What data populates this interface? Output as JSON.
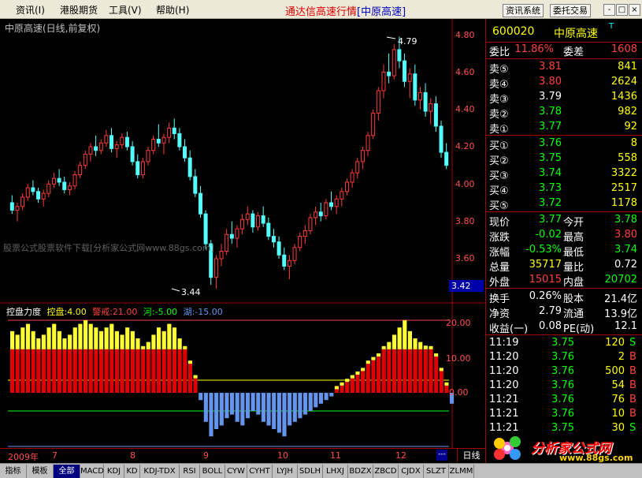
{
  "menu": {
    "items": [
      "资讯(I)",
      "港股期货",
      "工具(V)",
      "帮助(H)"
    ]
  },
  "app_title": {
    "main": "通达信高速行情",
    "sub": "[中原高速]"
  },
  "top_buttons": [
    "资讯系统",
    "委托交易"
  ],
  "window_buttons": [
    "-",
    "□",
    "×"
  ],
  "chart": {
    "title": "中原高速(日线,前复权)",
    "y_ticks": [
      "4.80",
      "4.60",
      "4.40",
      "4.20",
      "4.00",
      "3.80",
      "3.60"
    ],
    "cursor_price": "3.42",
    "high_annot": "4.79",
    "low_annot": "3.44",
    "watermark": "股票公式股票软件下载[分析家公式网www.88gs.com]",
    "indicator_ticks": [
      "20.00",
      "10.00",
      "0.00"
    ]
  },
  "indicator": {
    "name": "控盘力度",
    "items": [
      {
        "label": "控盘:4.00",
        "color": "#ffff00"
      },
      {
        "label": "警戒:21.00",
        "color": "#ff4040"
      },
      {
        "label": "河:-5.00",
        "color": "#00ff00"
      },
      {
        "label": "湖:-15.00",
        "color": "#6495ed"
      }
    ]
  },
  "chart_data": {
    "type": "candlestick",
    "high": 4.79,
    "low": 3.44,
    "candles": [
      [
        3.9,
        3.94,
        3.84,
        3.86
      ],
      [
        3.86,
        3.9,
        3.8,
        3.88
      ],
      [
        3.88,
        3.95,
        3.86,
        3.93
      ],
      [
        3.93,
        4.0,
        3.91,
        3.98
      ],
      [
        3.98,
        4.02,
        3.94,
        3.96
      ],
      [
        3.96,
        3.98,
        3.9,
        3.92
      ],
      [
        3.92,
        3.97,
        3.88,
        3.95
      ],
      [
        3.95,
        4.02,
        3.93,
        4.0
      ],
      [
        4.0,
        4.06,
        3.98,
        4.03
      ],
      [
        4.03,
        4.08,
        3.99,
        4.01
      ],
      [
        4.01,
        4.04,
        3.95,
        3.97
      ],
      [
        3.97,
        4.01,
        3.94,
        3.99
      ],
      [
        3.99,
        4.07,
        3.97,
        4.05
      ],
      [
        4.05,
        4.12,
        4.03,
        4.1
      ],
      [
        4.1,
        4.18,
        4.08,
        4.16
      ],
      [
        4.16,
        4.22,
        4.12,
        4.2
      ],
      [
        4.2,
        4.26,
        4.15,
        4.18
      ],
      [
        4.18,
        4.24,
        4.16,
        4.22
      ],
      [
        4.22,
        4.29,
        4.2,
        4.26
      ],
      [
        4.26,
        4.3,
        4.17,
        4.19
      ],
      [
        4.19,
        4.23,
        4.14,
        4.21
      ],
      [
        4.21,
        4.27,
        4.19,
        4.25
      ],
      [
        4.25,
        4.28,
        4.18,
        4.2
      ],
      [
        4.2,
        4.23,
        4.1,
        4.12
      ],
      [
        4.12,
        4.16,
        4.03,
        4.05
      ],
      [
        4.05,
        4.14,
        4.03,
        4.12
      ],
      [
        4.12,
        4.2,
        4.1,
        4.18
      ],
      [
        4.18,
        4.26,
        4.16,
        4.24
      ],
      [
        4.24,
        4.32,
        4.2,
        4.22
      ],
      [
        4.22,
        4.27,
        4.16,
        4.25
      ],
      [
        4.25,
        4.33,
        4.22,
        4.3
      ],
      [
        4.3,
        4.35,
        4.24,
        4.27
      ],
      [
        4.27,
        4.3,
        4.18,
        4.2
      ],
      [
        4.2,
        4.24,
        4.12,
        4.14
      ],
      [
        4.14,
        4.18,
        4.02,
        4.04
      ],
      [
        4.04,
        4.08,
        3.93,
        3.95
      ],
      [
        3.95,
        3.99,
        3.82,
        3.84
      ],
      [
        3.84,
        3.86,
        3.65,
        3.68
      ],
      [
        3.68,
        3.7,
        3.46,
        3.5
      ],
      [
        3.5,
        3.62,
        3.44,
        3.6
      ],
      [
        3.6,
        3.68,
        3.56,
        3.64
      ],
      [
        3.64,
        3.76,
        3.62,
        3.73
      ],
      [
        3.73,
        3.8,
        3.68,
        3.71
      ],
      [
        3.71,
        3.78,
        3.66,
        3.76
      ],
      [
        3.76,
        3.84,
        3.73,
        3.81
      ],
      [
        3.81,
        3.88,
        3.78,
        3.84
      ],
      [
        3.84,
        3.86,
        3.74,
        3.77
      ],
      [
        3.77,
        3.85,
        3.75,
        3.83
      ],
      [
        3.83,
        3.88,
        3.77,
        3.79
      ],
      [
        3.79,
        3.82,
        3.7,
        3.72
      ],
      [
        3.72,
        3.76,
        3.66,
        3.69
      ],
      [
        3.69,
        3.72,
        3.6,
        3.62
      ],
      [
        3.62,
        3.66,
        3.54,
        3.56
      ],
      [
        3.56,
        3.62,
        3.49,
        3.59
      ],
      [
        3.59,
        3.68,
        3.57,
        3.66
      ],
      [
        3.66,
        3.74,
        3.64,
        3.72
      ],
      [
        3.72,
        3.78,
        3.68,
        3.75
      ],
      [
        3.75,
        3.84,
        3.73,
        3.82
      ],
      [
        3.82,
        3.88,
        3.78,
        3.85
      ],
      [
        3.85,
        3.9,
        3.8,
        3.83
      ],
      [
        3.83,
        3.92,
        3.81,
        3.9
      ],
      [
        3.9,
        3.96,
        3.86,
        3.88
      ],
      [
        3.88,
        3.94,
        3.84,
        3.92
      ],
      [
        3.92,
        3.98,
        3.88,
        3.96
      ],
      [
        3.96,
        4.03,
        3.94,
        4.01
      ],
      [
        4.01,
        4.08,
        3.98,
        4.06
      ],
      [
        4.06,
        4.14,
        4.03,
        4.12
      ],
      [
        4.12,
        4.2,
        4.08,
        4.18
      ],
      [
        4.18,
        4.28,
        4.15,
        4.26
      ],
      [
        4.26,
        4.4,
        4.24,
        4.38
      ],
      [
        4.38,
        4.52,
        4.34,
        4.5
      ],
      [
        4.5,
        4.64,
        4.46,
        4.6
      ],
      [
        4.6,
        4.7,
        4.54,
        4.58
      ],
      [
        4.58,
        4.75,
        4.56,
        4.72
      ],
      [
        4.72,
        4.79,
        4.62,
        4.66
      ],
      [
        4.66,
        4.7,
        4.52,
        4.55
      ],
      [
        4.55,
        4.62,
        4.46,
        4.59
      ],
      [
        4.59,
        4.64,
        4.42,
        4.45
      ],
      [
        4.45,
        4.52,
        4.4,
        4.49
      ],
      [
        4.49,
        4.54,
        4.36,
        4.39
      ],
      [
        4.39,
        4.46,
        4.32,
        4.43
      ],
      [
        4.43,
        4.47,
        4.28,
        4.31
      ],
      [
        4.31,
        4.34,
        4.14,
        4.17
      ],
      [
        4.17,
        4.22,
        4.08,
        4.1
      ]
    ],
    "indicator_values": [
      17,
      16,
      18,
      19,
      17,
      15,
      16,
      18,
      19,
      17,
      15,
      16,
      18,
      19,
      20,
      19,
      18,
      17,
      18,
      19,
      17,
      16,
      18,
      17,
      15,
      12,
      14,
      16,
      18,
      17,
      19,
      18,
      15,
      12,
      8,
      4,
      -2,
      -8,
      -12,
      -10,
      -9,
      -7,
      -6,
      -8,
      -9,
      -7,
      -5,
      -6,
      -8,
      -9,
      -10,
      -11,
      -12,
      -9,
      -8,
      -7,
      -6,
      -5,
      -4,
      -3,
      -2,
      -1,
      1,
      2,
      3,
      4,
      5,
      6,
      8,
      9,
      10,
      12,
      14,
      16,
      18,
      20,
      17,
      15,
      14,
      13,
      12,
      10,
      6,
      2,
      -3
    ]
  },
  "date_axis": [
    "2009年",
    "7",
    "8",
    "9",
    "10",
    "11",
    "12"
  ],
  "period": "日线",
  "scroll_mark": "---",
  "tabs": [
    "指标",
    "模板",
    "全部",
    "MACD",
    "KDJ",
    "KD",
    "KDJ-TDX",
    "RSI",
    "BOLL",
    "CYW",
    "CYHT",
    "LYJH",
    "SDLH",
    "LHXJ",
    "BDZX",
    "ZBCD",
    "CJDX",
    "SLZT",
    "ZLMM"
  ],
  "stock": {
    "code": "600020",
    "name": "中原高速",
    "flag": "T"
  },
  "weibi": {
    "label": "委比",
    "value": "11.86%",
    "label2": "委差",
    "value2": "1608"
  },
  "asks": [
    {
      "label": "卖⑤",
      "price": "3.81",
      "vol": "841"
    },
    {
      "label": "卖④",
      "price": "3.80",
      "vol": "2624"
    },
    {
      "label": "卖③",
      "price": "3.79",
      "vol": "1436"
    },
    {
      "label": "卖②",
      "price": "3.78",
      "vol": "982"
    },
    {
      "label": "卖①",
      "price": "3.77",
      "vol": "92"
    }
  ],
  "bids": [
    {
      "label": "买①",
      "price": "3.76",
      "vol": "8"
    },
    {
      "label": "买②",
      "price": "3.75",
      "vol": "558"
    },
    {
      "label": "买③",
      "price": "3.74",
      "vol": "3322"
    },
    {
      "label": "买④",
      "price": "3.73",
      "vol": "2517"
    },
    {
      "label": "买⑤",
      "price": "3.72",
      "vol": "1178"
    }
  ],
  "quote": [
    {
      "l1": "现价",
      "v1": "3.77",
      "c1": "green",
      "l2": "今开",
      "v2": "3.78",
      "c2": "green"
    },
    {
      "l1": "涨跌",
      "v1": "-0.02",
      "c1": "green",
      "l2": "最高",
      "v2": "3.80",
      "c2": "red"
    },
    {
      "l1": "涨幅",
      "v1": "-0.53%",
      "c1": "green",
      "l2": "最低",
      "v2": "3.74",
      "c2": "green"
    },
    {
      "l1": "总量",
      "v1": "35717",
      "c1": "yellow",
      "l2": "量比",
      "v2": "0.72",
      "c2": "white"
    },
    {
      "l1": "外盘",
      "v1": "15015",
      "c1": "red",
      "l2": "内盘",
      "v2": "20702",
      "c2": "green"
    }
  ],
  "fundamentals": [
    {
      "l1": "换手",
      "v1": "0.26%",
      "l2": "股本",
      "v2": "21.4亿"
    },
    {
      "l1": "净资",
      "v1": "2.79",
      "l2": "流通",
      "v2": "13.9亿"
    },
    {
      "l1": "收益(一)",
      "v1": "0.08",
      "l2": "PE(动)",
      "v2": "12.1"
    }
  ],
  "ticks": [
    {
      "time": "11:19",
      "price": "3.75",
      "vol": "120",
      "side": "S",
      "vol_color": "yellow",
      "side_color": "green"
    },
    {
      "time": "11:20",
      "price": "3.76",
      "vol": "2",
      "side": "B",
      "vol_color": "yellow",
      "side_color": "red"
    },
    {
      "time": "11:20",
      "price": "3.76",
      "vol": "500",
      "side": "B",
      "vol_color": "magenta",
      "side_color": "red"
    },
    {
      "time": "11:20",
      "price": "3.76",
      "vol": "54",
      "side": "B",
      "vol_color": "yellow",
      "side_color": "red"
    },
    {
      "time": "11:21",
      "price": "3.76",
      "vol": "76",
      "side": "B",
      "vol_color": "yellow",
      "side_color": "red"
    },
    {
      "time": "11:21",
      "price": "3.76",
      "vol": "10",
      "side": "B",
      "vol_color": "yellow",
      "side_color": "red"
    },
    {
      "time": "11:21",
      "price": "3.75",
      "vol": "30",
      "side": "S",
      "vol_color": "yellow",
      "side_color": "green"
    }
  ],
  "logo": {
    "text": "分析家公式网",
    "url": "www.88gs.com"
  }
}
